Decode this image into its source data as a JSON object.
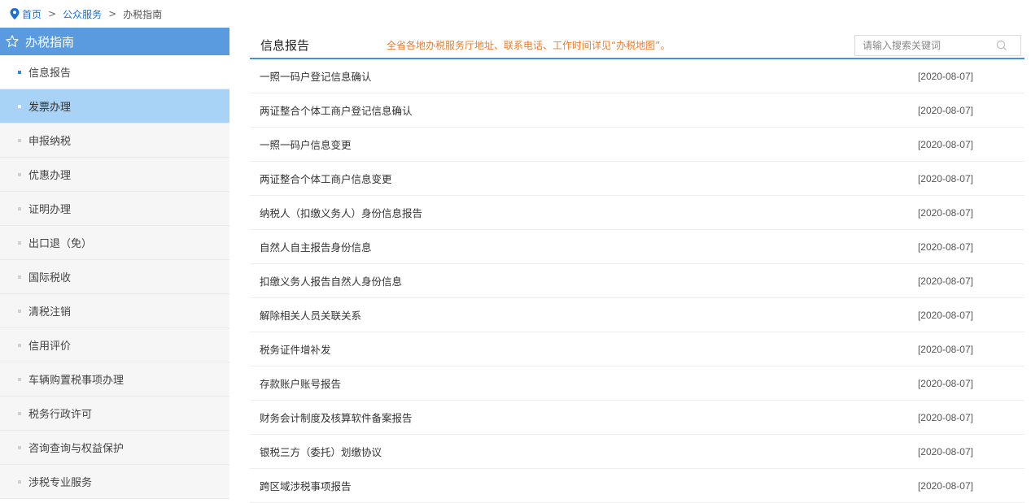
{
  "breadcrumb": {
    "home": "首页",
    "sep": ">",
    "public_service": "公众服务",
    "current": "办税指南"
  },
  "sidebar": {
    "title": "办税指南",
    "items": [
      {
        "label": "信息报告"
      },
      {
        "label": "发票办理"
      },
      {
        "label": "申报纳税"
      },
      {
        "label": "优惠办理"
      },
      {
        "label": "证明办理"
      },
      {
        "label": "出口退（免）"
      },
      {
        "label": "国际税收"
      },
      {
        "label": "清税注销"
      },
      {
        "label": "信用评价"
      },
      {
        "label": "车辆购置税事项办理"
      },
      {
        "label": "税务行政许可"
      },
      {
        "label": "咨询查询与权益保护"
      },
      {
        "label": "涉税专业服务"
      }
    ]
  },
  "main": {
    "title": "信息报告",
    "notice": "全省各地办税服务厅地址、联系电话、工作时间详见“办税地图”。",
    "search_placeholder": "请输入搜索关键词",
    "rows": [
      {
        "title": "一照一码户登记信息确认",
        "date": "[2020-08-07]"
      },
      {
        "title": "两证整合个体工商户登记信息确认",
        "date": "[2020-08-07]"
      },
      {
        "title": "一照一码户信息变更",
        "date": "[2020-08-07]"
      },
      {
        "title": "两证整合个体工商户信息变更",
        "date": "[2020-08-07]"
      },
      {
        "title": "纳税人（扣缴义务人）身份信息报告",
        "date": "[2020-08-07]"
      },
      {
        "title": "自然人自主报告身份信息",
        "date": "[2020-08-07]"
      },
      {
        "title": "扣缴义务人报告自然人身份信息",
        "date": "[2020-08-07]"
      },
      {
        "title": "解除相关人员关联关系",
        "date": "[2020-08-07]"
      },
      {
        "title": "税务证件增补发",
        "date": "[2020-08-07]"
      },
      {
        "title": "存款账户账号报告",
        "date": "[2020-08-07]"
      },
      {
        "title": "财务会计制度及核算软件备案报告",
        "date": "[2020-08-07]"
      },
      {
        "title": "银税三方（委托）划缴协议",
        "date": "[2020-08-07]"
      },
      {
        "title": "跨区域涉税事项报告",
        "date": "[2020-08-07]"
      }
    ]
  },
  "icons": {
    "location": "location-pin-icon",
    "star": "star-outline-icon",
    "search": "search-icon"
  },
  "colors": {
    "link": "#1a6fd1",
    "sidebar_header": "#5a9be0",
    "sidebar_active": "#a8d2f6",
    "notice": "#f07d2c",
    "accent_line": "#4a8fe0"
  }
}
